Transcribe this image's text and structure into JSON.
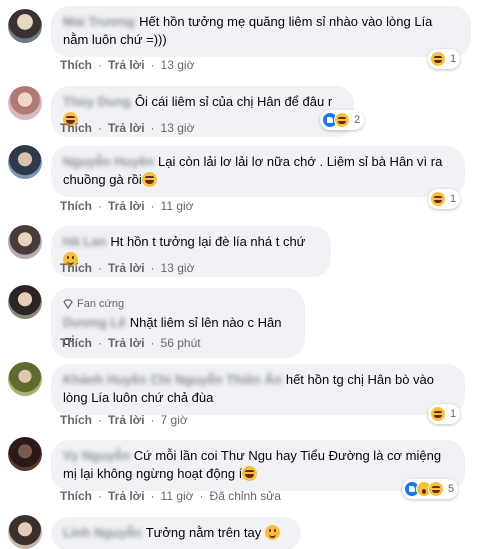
{
  "labels": {
    "like": "Thích",
    "reply": "Trả lời",
    "edited": "Đã chỉnh sửa",
    "fan_badge": "Fan cứng"
  },
  "comments": [
    {
      "name": "Mai Trương",
      "text": "Hết hồn tưởng mẹ quăng liêm sỉ nhào vào lòng Lía nằm luôn chứ =)))",
      "time": "13 giờ",
      "reactions": [
        "haha"
      ],
      "reaction_count": "1"
    },
    {
      "name": "Thùy Dung",
      "text": "Ôi cái liêm sỉ của chị Hân để đâu r",
      "time": "13 giờ",
      "reactions": [
        "like",
        "haha"
      ],
      "reaction_count": "2"
    },
    {
      "name": "Nguyễn Huyền",
      "text": "Lại còn lải lơ lải lơ nữa chớ . Liêm sỉ bà Hân vì ra chuồng gà rồi",
      "time": "11 giờ",
      "reactions": [
        "haha"
      ],
      "reaction_count": "1"
    },
    {
      "name": "Hà Lan",
      "text": "Ht hồn t tưởng lại đè lía nhá t chứ",
      "time": "13 giờ",
      "reactions": [],
      "reaction_count": ""
    },
    {
      "name": "Dương Lê",
      "text": "Nhặt liêm sỉ lên nào c Hân ơi",
      "time": "56 phút",
      "reactions": [],
      "reaction_count": ""
    },
    {
      "name": "Khánh Huyền Chi Nguyễn Thiên Ân",
      "text": "hết hồn tg chị Hân bò vào lòng Lía luôn chứ chả đùa",
      "time": "7 giờ",
      "reactions": [
        "haha"
      ],
      "reaction_count": "1"
    },
    {
      "name": "Vy Nguyễn",
      "text": "Cứ mỗi lần coi Thư Ngu hay Tiểu Đường là cơ miệng mị lại không ngừng hoạt động í",
      "time": "11 giờ",
      "reactions": [
        "like",
        "wow",
        "haha"
      ],
      "reaction_count": "5"
    },
    {
      "name": "Linh Nguyễn",
      "text": "Tưởng nằm trên tay",
      "time": "",
      "reactions": [],
      "reaction_count": ""
    }
  ]
}
